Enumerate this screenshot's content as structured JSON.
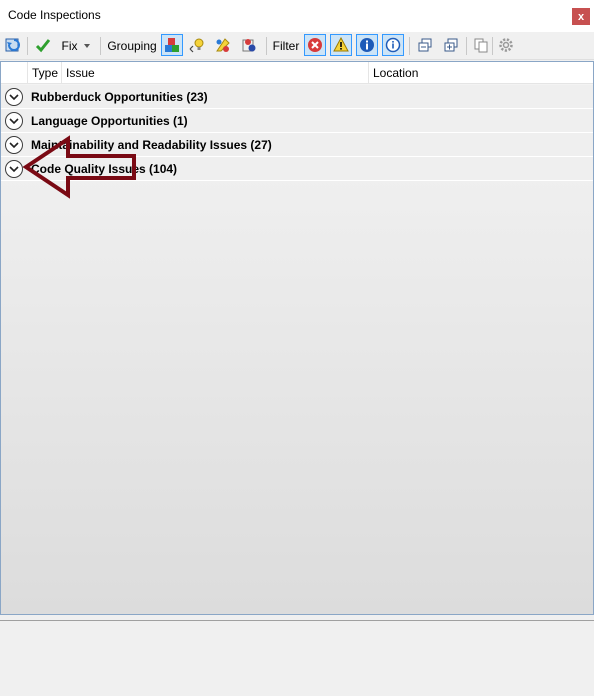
{
  "window": {
    "title": "Code Inspections",
    "close_label": "x"
  },
  "toolbar": {
    "fix_label": "Fix",
    "grouping_label": "Grouping",
    "filter_label": "Filter"
  },
  "columns": {
    "type": "Type",
    "issue": "Issue",
    "location": "Location"
  },
  "groups": [
    {
      "label": "Rubberduck Opportunities   (23)"
    },
    {
      "label": "Language Opportunities   (1)"
    },
    {
      "label": "Maintainability and Readability Issues   (27)"
    },
    {
      "label": "Code Quality Issues   (104)"
    }
  ],
  "colors": {
    "arrow": "#7a0a14",
    "accent": "#3399ff"
  }
}
